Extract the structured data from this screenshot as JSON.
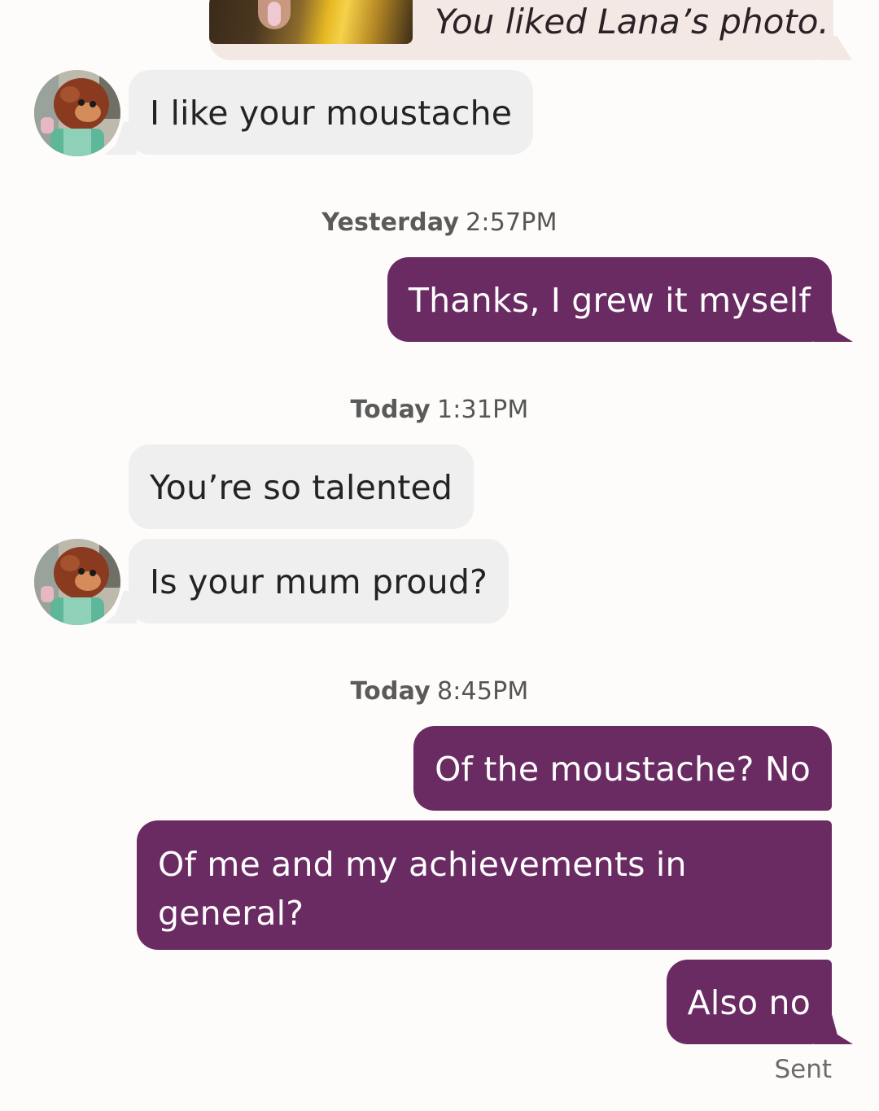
{
  "liked_photo": {
    "text": "You liked Lana’s photo."
  },
  "messages": [
    {
      "id": "m1",
      "text": "I like your moustache"
    },
    {
      "id": "m2",
      "text": "Thanks, I grew it myself"
    },
    {
      "id": "m3",
      "text": "You’re so talented"
    },
    {
      "id": "m4",
      "text": "Is your mum proud?"
    },
    {
      "id": "m5",
      "text": "Of the moustache? No"
    },
    {
      "id": "m6",
      "text": "Of me and my achievements in general?"
    },
    {
      "id": "m7",
      "text": "Also no"
    }
  ],
  "timestamps": [
    {
      "day": "Yesterday",
      "time": "2:57PM"
    },
    {
      "day": "Today",
      "time": "1:31PM"
    },
    {
      "day": "Today",
      "time": "8:45PM"
    }
  ],
  "status": "Sent",
  "colors": {
    "outgoing_bubble": "#6a2a62",
    "incoming_bubble": "#efefef",
    "liked_card": "#f3e8e3",
    "background": "#fdfcfa"
  },
  "icons": {
    "avatar": "puppet-monkey-avatar"
  }
}
